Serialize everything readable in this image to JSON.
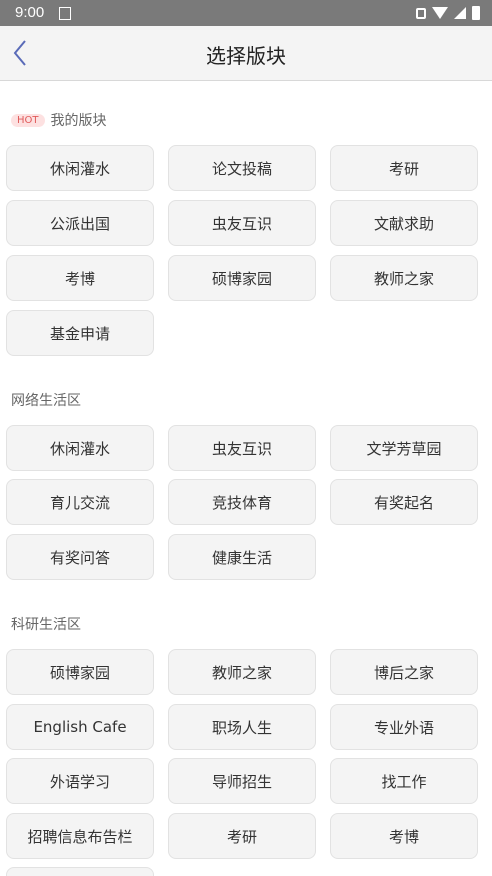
{
  "status": {
    "time": "9:00"
  },
  "header": {
    "title": "选择版块"
  },
  "sections": [
    {
      "hot": "HOT",
      "label": "我的版块",
      "items": [
        "休闲灌水",
        "论文投稿",
        "考研",
        "公派出国",
        "虫友互识",
        "文献求助",
        "考博",
        "硕博家园",
        "教师之家",
        "基金申请"
      ]
    },
    {
      "label": "网络生活区",
      "items": [
        "休闲灌水",
        "虫友互识",
        "文学芳草园",
        "育儿交流",
        "竞技体育",
        "有奖起名",
        "有奖问答",
        "健康生活"
      ]
    },
    {
      "label": "科研生活区",
      "items": [
        "硕博家园",
        "教师之家",
        "博后之家",
        "English Cafe",
        "职场人生",
        "专业外语",
        "外语学习",
        "导师招生",
        "找工作",
        "招聘信息布告栏",
        "考研",
        "考博"
      ]
    }
  ]
}
